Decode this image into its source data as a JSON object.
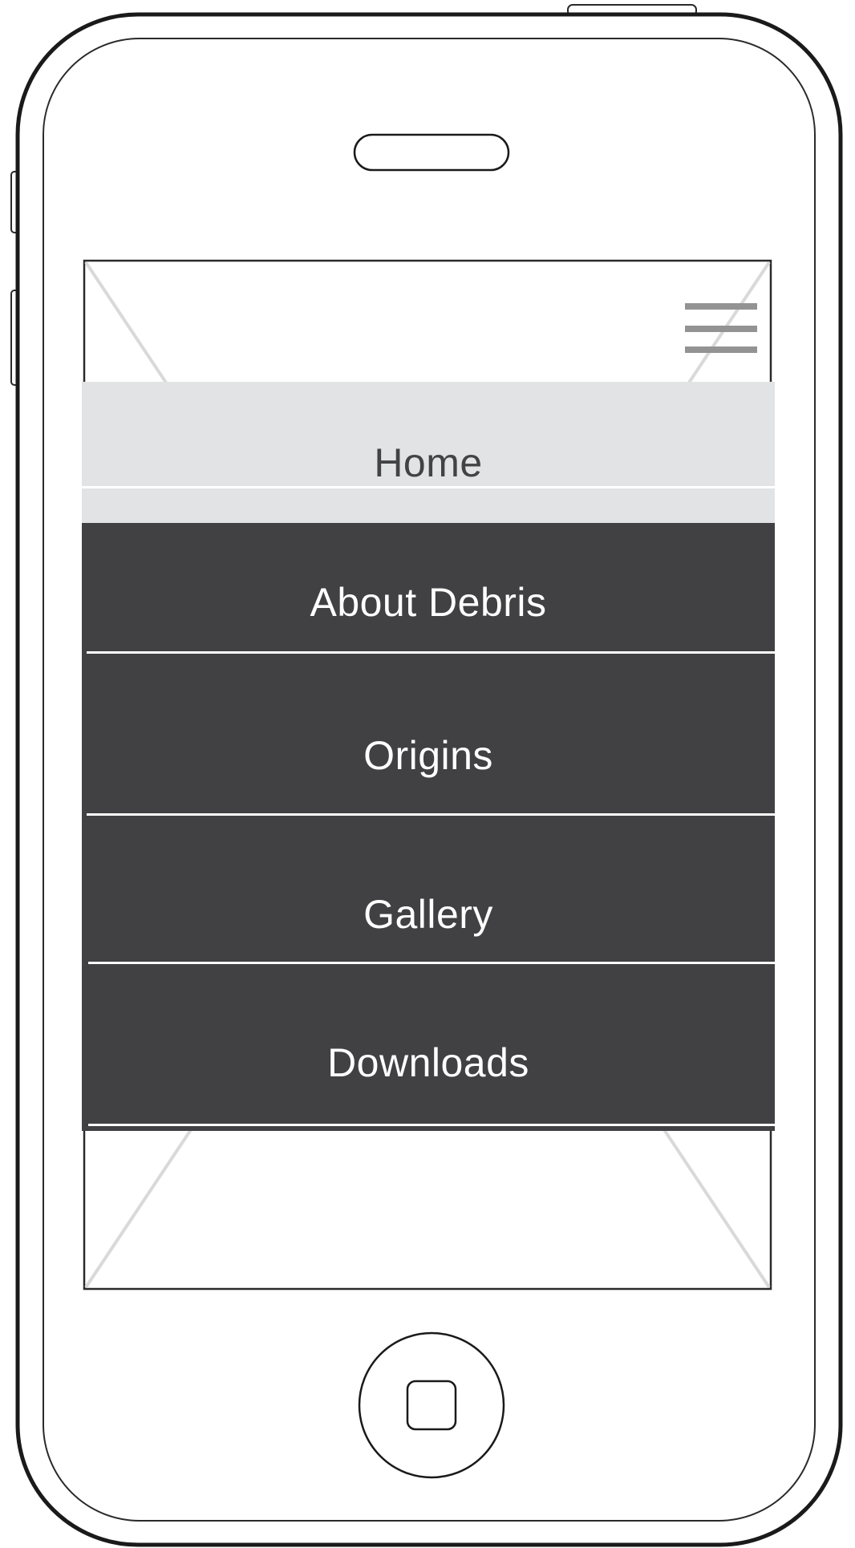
{
  "menu": {
    "items": [
      {
        "label": "Home",
        "state": "active"
      },
      {
        "label": "About Debris"
      },
      {
        "label": "Origins"
      },
      {
        "label": "Gallery"
      },
      {
        "label": "Downloads"
      }
    ]
  },
  "icons": {
    "menu_toggle": "hamburger-icon",
    "speaker": "speaker-slot-icon",
    "home_button": "home-button-icon"
  },
  "colors": {
    "active_item_bg": "#e2e3e5",
    "active_item_text": "#434345",
    "item_bg": "#414042",
    "item_text": "#ffffff",
    "hamburger": "#939393",
    "placeholder_cross": "#d9d9d9"
  }
}
